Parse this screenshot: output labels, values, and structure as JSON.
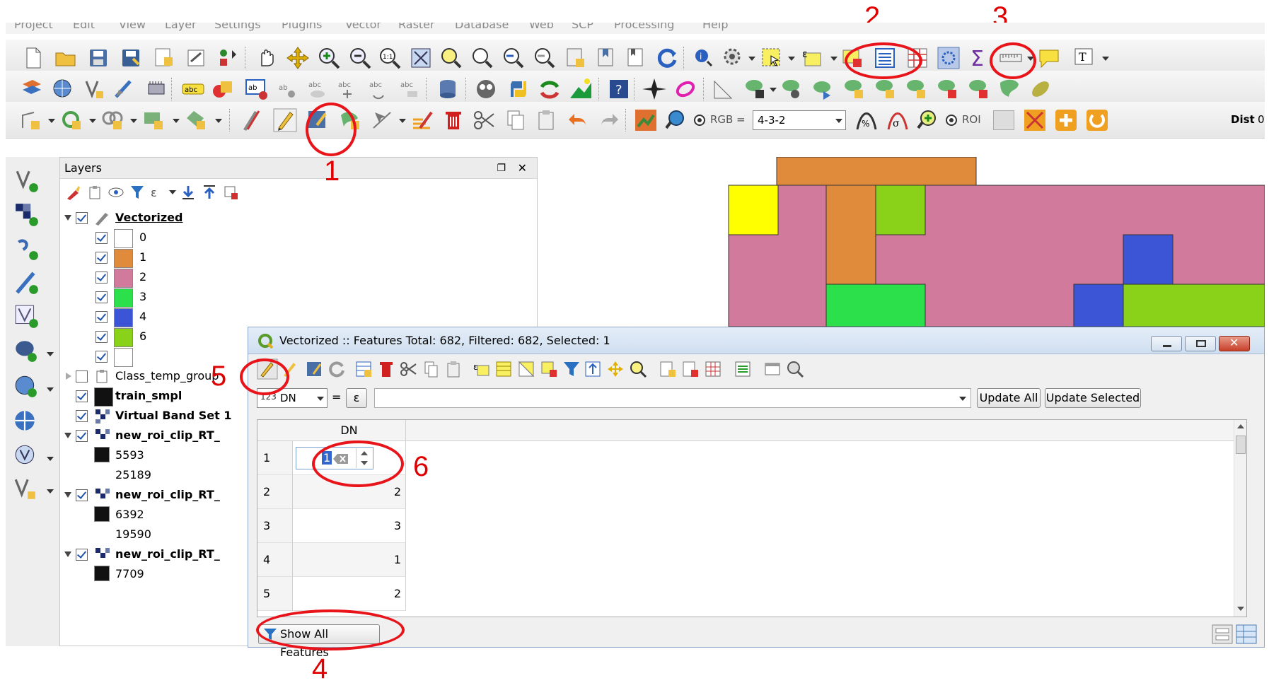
{
  "menu": [
    "Project",
    "Edit",
    "View",
    "Layer",
    "Settings",
    "Plugins",
    "Vector",
    "Raster",
    "Database",
    "Web",
    "SCP",
    "Processing",
    "Help"
  ],
  "toolbar3": {
    "band_label": "RGB =",
    "band_value": "4-3-2",
    "roi_label": "ROI",
    "dist_label": "Dist",
    "dist_value": "0"
  },
  "layers": {
    "title": "Layers",
    "items": [
      {
        "label": "Vectorized"
      },
      {
        "label": "0"
      },
      {
        "label": "1"
      },
      {
        "label": "2"
      },
      {
        "label": "3"
      },
      {
        "label": "4"
      },
      {
        "label": "6"
      },
      {
        "label": ""
      },
      {
        "label": "Class_temp_group"
      },
      {
        "label": "train_smpl"
      },
      {
        "label": "Virtual Band Set 1"
      },
      {
        "label": "new_roi_clip_RT_"
      },
      {
        "label": "5593"
      },
      {
        "label": "25189"
      },
      {
        "label": "new_roi_clip_RT_"
      },
      {
        "label": "6392"
      },
      {
        "label": "19590"
      },
      {
        "label": "new_roi_clip_RT_"
      },
      {
        "label": "7709"
      }
    ]
  },
  "legend_colors": [
    "#ffffff",
    "#e08a3c",
    "#d27a9b",
    "#2be04a",
    "#3b55d6",
    "#8ad21a",
    "#ffffff"
  ],
  "attribute_table": {
    "title": "Vectorized :: Features Total: 682, Filtered: 682, Selected: 1",
    "field_type": "123",
    "field": "DN",
    "equals": "=",
    "epsilon": "ε",
    "update_all": "Update All",
    "update_selected": "Update Selected",
    "column": "DN",
    "editing_value": "1",
    "rows": [
      {
        "id": "1",
        "dn": "1"
      },
      {
        "id": "2",
        "dn": "2"
      },
      {
        "id": "3",
        "dn": "3"
      },
      {
        "id": "4",
        "dn": "1"
      },
      {
        "id": "5",
        "dn": "2"
      }
    ],
    "show_features": "Show All Features"
  },
  "callouts": [
    "1",
    "2",
    "3",
    "4",
    "5",
    "6"
  ],
  "colors": {
    "callout": "#e8141a"
  }
}
